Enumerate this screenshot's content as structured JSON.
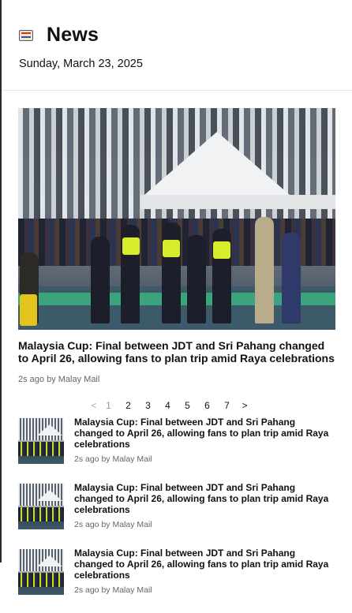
{
  "header": {
    "icon": "newspaper-icon",
    "title": "News",
    "date": "Sunday, March 23, 2025"
  },
  "featured": {
    "title": "Malaysia Cup: Final between JDT and Sri Pahang changed to April 26, allowing fans to plan trip amid Raya celebrations",
    "meta": "2s ago by Malay Mail"
  },
  "pagination": {
    "prev": "<",
    "next": ">",
    "pages": [
      "1",
      "2",
      "3",
      "4",
      "5",
      "6",
      "7"
    ],
    "current": "1"
  },
  "articles": [
    {
      "title": "Malaysia Cup: Final between JDT and Sri Pahang changed to April 26, allowing fans to plan trip amid Raya celebrations",
      "meta": "2s ago by Malay Mail"
    },
    {
      "title": "Malaysia Cup: Final between JDT and Sri Pahang changed to April 26, allowing fans to plan trip amid Raya celebrations",
      "meta": "2s ago by Malay Mail"
    },
    {
      "title": "Malaysia Cup: Final between JDT and Sri Pahang changed to April 26, allowing fans to plan trip amid Raya celebrations",
      "meta": "2s ago by Malay Mail"
    }
  ]
}
